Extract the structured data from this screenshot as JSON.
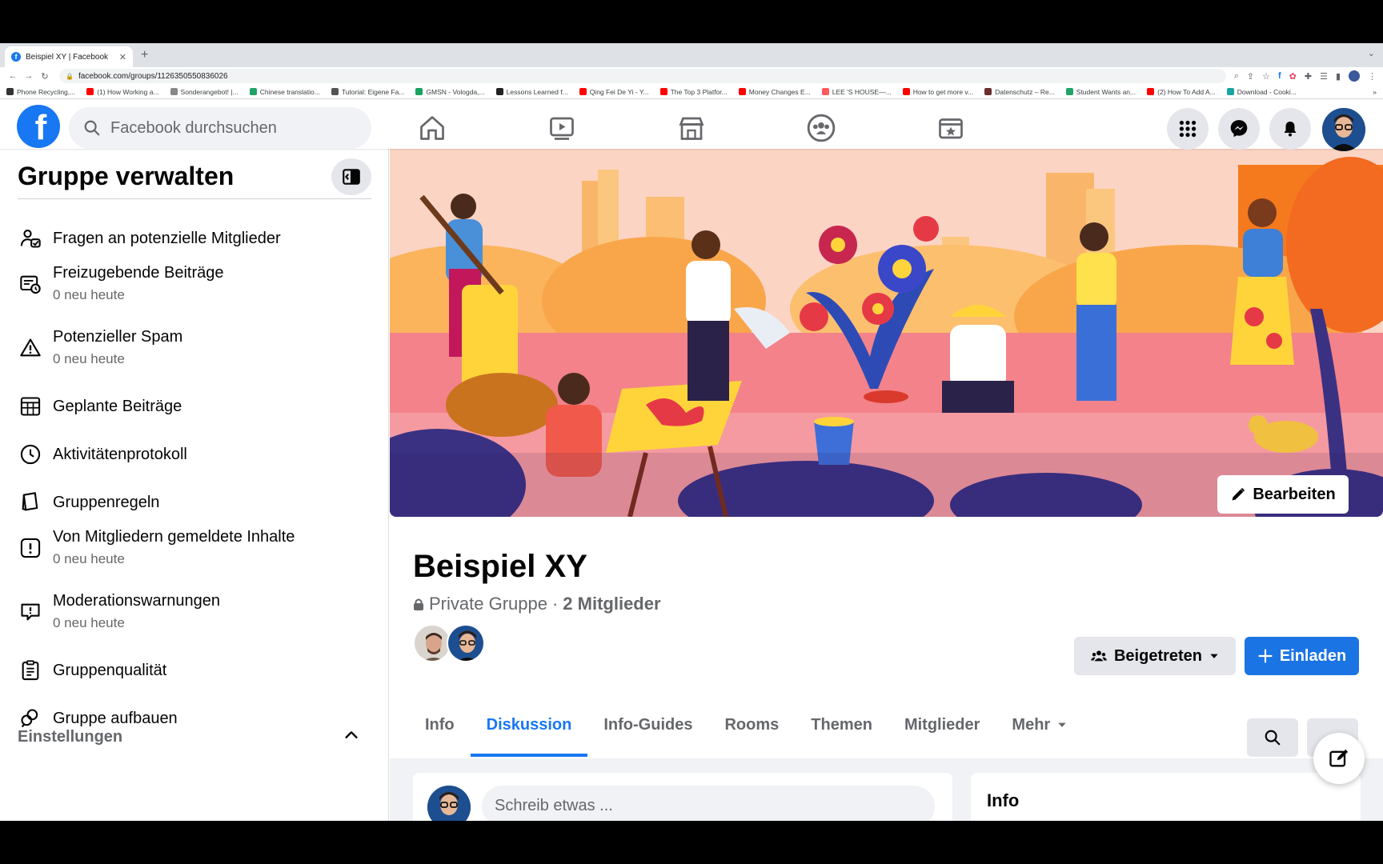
{
  "browser": {
    "tab_title": "Beispiel XY | Facebook",
    "url": "facebook.com/groups/1126350550836026",
    "bookmarks": [
      {
        "label": "Phone Recycling,...",
        "color": "#333333"
      },
      {
        "label": "(1) How Working a...",
        "color": "#ff0000"
      },
      {
        "label": "Sonderangebot! |...",
        "color": "#888888"
      },
      {
        "label": "Chinese translatio...",
        "color": "#21a366"
      },
      {
        "label": "Tutorial: Eigene Fa...",
        "color": "#555555"
      },
      {
        "label": "GMSN - Vologda,...",
        "color": "#1aa260"
      },
      {
        "label": "Lessons Learned f...",
        "color": "#222222"
      },
      {
        "label": "Qing Fei De Yi - Y...",
        "color": "#ff0000"
      },
      {
        "label": "The Top 3 Platfor...",
        "color": "#ff0000"
      },
      {
        "label": "Money Changes E...",
        "color": "#ff0000"
      },
      {
        "label": "LEE 'S HOUSE—...",
        "color": "#ff5a5f"
      },
      {
        "label": "How to get more v...",
        "color": "#ff0000"
      },
      {
        "label": "Datenschutz – Re...",
        "color": "#6b2f2f"
      },
      {
        "label": "Student Wants an...",
        "color": "#21a366"
      },
      {
        "label": "(2) How To Add A...",
        "color": "#ff0000"
      },
      {
        "label": "Download - Cooki...",
        "color": "#1aa3a3"
      }
    ]
  },
  "topnav": {
    "search_placeholder": "Facebook durchsuchen"
  },
  "sidebar": {
    "title": "Gruppe verwalten",
    "items": [
      {
        "label": "Fragen an potenzielle Mitglieder",
        "sub": ""
      },
      {
        "label": "Freizugebende Beiträge",
        "sub": "0 neu heute"
      },
      {
        "label": "Potenzieller Spam",
        "sub": "0 neu heute"
      },
      {
        "label": "Geplante Beiträge",
        "sub": ""
      },
      {
        "label": "Aktivitätenprotokoll",
        "sub": ""
      },
      {
        "label": "Gruppenregeln",
        "sub": ""
      },
      {
        "label": "Von Mitgliedern gemeldete Inhalte",
        "sub": "0 neu heute"
      },
      {
        "label": "Moderationswarnungen",
        "sub": "0 neu heute"
      },
      {
        "label": "Gruppenqualität",
        "sub": ""
      },
      {
        "label": "Gruppe aufbauen",
        "sub": ""
      }
    ],
    "settings_label": "Einstellungen"
  },
  "group": {
    "edit_label": "Bearbeiten",
    "name": "Beispiel XY",
    "privacy": "Private Gruppe",
    "separator": "·",
    "members": "2 Mitglieder",
    "joined_label": "Beigetreten",
    "invite_label": "Einladen",
    "tabs": [
      "Info",
      "Diskussion",
      "Info-Guides",
      "Rooms",
      "Themen",
      "Mitglieder",
      "Mehr"
    ],
    "active_tab": "Diskussion",
    "composer_placeholder": "Schreib etwas ...",
    "info_card_title": "Info"
  },
  "colors": {
    "brand": "#1877f2",
    "cover_bg": "#fdd0c2"
  }
}
